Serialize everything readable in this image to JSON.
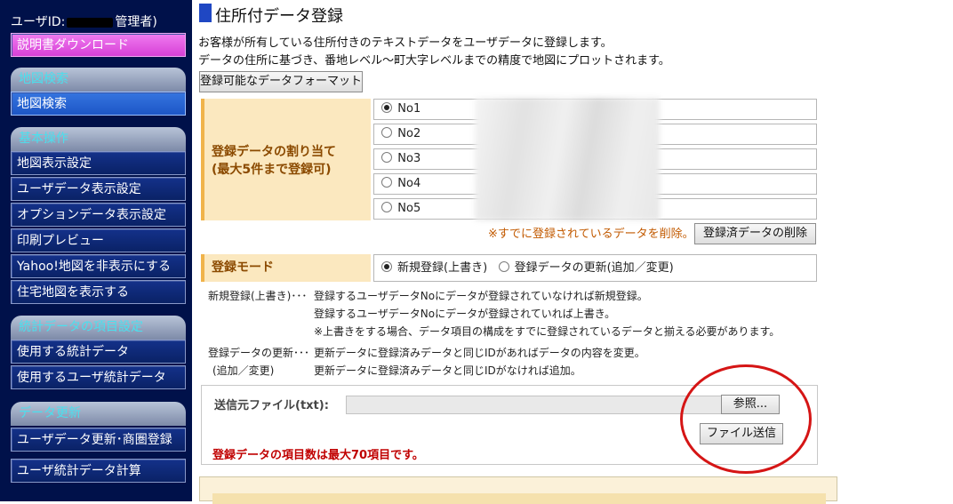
{
  "sidebar": {
    "user_prefix": "ユーザID:",
    "user_suffix": "管理者)",
    "manual_download": "説明書ダウンロード",
    "sections": [
      {
        "header": "地図検索",
        "items": [
          "地図検索"
        ]
      },
      {
        "header": "基本操作",
        "items": [
          "地図表示設定",
          "ユーザデータ表示設定",
          "オプションデータ表示設定",
          "印刷プレビュー",
          "Yahoo!地図を非表示にする",
          "住宅地図を表示する"
        ]
      },
      {
        "header": "統計データの項目設定",
        "items": [
          "使用する統計データ",
          "使用するユーザ統計データ"
        ]
      },
      {
        "header": "データ更新",
        "items": [
          "ユーザデータ更新･商圏登録",
          "ユーザ統計データ計算"
        ]
      }
    ]
  },
  "main": {
    "title": "住所付データ登録",
    "desc1": "お客様が所有している住所付きのテキストデータをユーザデータに登録します。",
    "desc2": "データの住所に基づき、番地レベル～町大字レベルまでの精度で地図にプロットされます。",
    "format_button": "登録可能なデータフォーマット",
    "assign_label_1": "登録データの割り当て",
    "assign_label_2": "(最大5件まで登録可)",
    "slots": [
      "No1",
      "No2",
      "No3",
      "No4",
      "No5"
    ],
    "delete_note": "※すでに登録されているデータを削除。>",
    "delete_button": "登録済データの削除",
    "mode_label": "登録モード",
    "mode_new": "新規登録(上書き)",
    "mode_update": "登録データの更新(追加／変更)",
    "expl_new_head": "新規登録(上書き)･･･",
    "expl_new_1": "登録するユーザデータNoにデータが登録されていなければ新規登録。",
    "expl_new_2": "登録するユーザデータNoにデータが登録されていれば上書き。",
    "expl_new_3": "※上書きをする場合、データ項目の構成をすでに登録されているデータと揃える必要があります。",
    "expl_upd_head_1": "登録データの更新･･･",
    "expl_upd_head_2": "(追加／変更)",
    "expl_upd_1": "更新データに登録済みデータと同じIDがあればデータの内容を変更。",
    "expl_upd_2": "更新データに登録済みデータと同じIDがなければ追加。",
    "upload_label": "送信元ファイル(txt):",
    "browse_button": "参照...",
    "send_button": "ファイル送信",
    "limit_note": "登録データの項目数は最大70項目です。"
  }
}
